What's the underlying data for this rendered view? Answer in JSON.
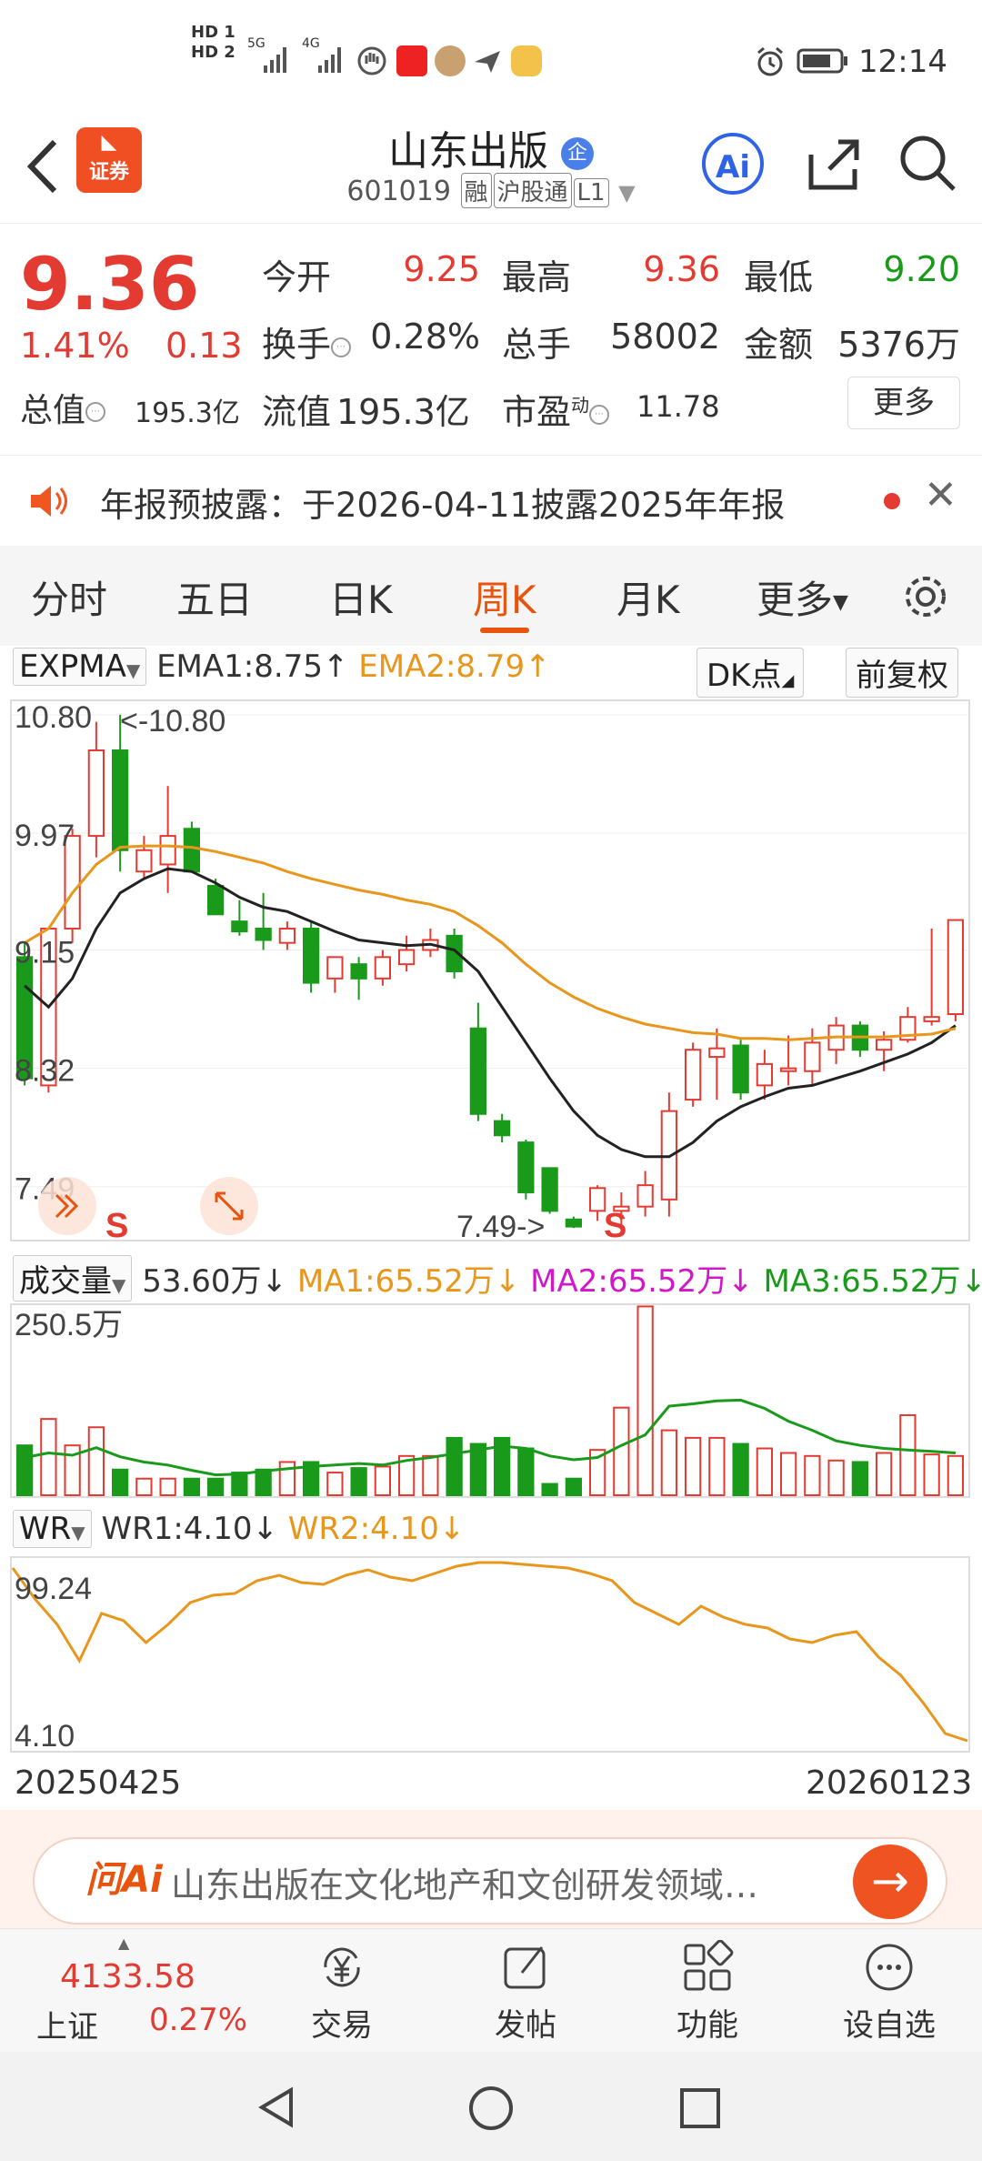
{
  "status_bar": {
    "time": "12:14",
    "sim1": "HD 1",
    "sim2": "HD 2",
    "net1": "5G",
    "net2": "4G"
  },
  "header": {
    "back_icon": "back-arrow-icon",
    "app_logo_label": "证券",
    "title": "山东出版",
    "title_badge": "企",
    "code": "601019",
    "tags": [
      "融",
      "沪股通",
      "L1"
    ],
    "ai_label": "Ai"
  },
  "quote": {
    "price": "9.36",
    "change_pct": "1.41%",
    "change": "0.13",
    "mktcap_label": "总值",
    "mktcap_value": "195.3亿",
    "open_label": "今开",
    "open_value": "9.25",
    "high_label": "最高",
    "high_value": "9.36",
    "low_label": "最低",
    "low_value": "9.20",
    "turnover_label": "换手",
    "turnover_value": "0.28%",
    "volume_label": "总手",
    "volume_value": "58002",
    "amount_label": "金额",
    "amount_value": "5376万",
    "float_label": "流值",
    "float_value": "195.3亿",
    "pe_label": "市盈",
    "pe_sup": "动",
    "pe_value": "11.78",
    "more_label": "更多"
  },
  "notice": {
    "text": "年报预披露：于2026-04-11披露2025年年报"
  },
  "tabs": {
    "items": [
      "分时",
      "五日",
      "日K",
      "周K",
      "月K",
      "更多"
    ],
    "active": "周K"
  },
  "ema_header": {
    "indicator": "EXPMA",
    "ema1": "EMA1:8.75↑",
    "ema2": "EMA2:8.79↑",
    "dk_label": "DK点",
    "adjust_label": "前复权"
  },
  "vol_header": {
    "indicator": "成交量",
    "value": "53.60万↓",
    "ma1": "MA1:65.52万↓",
    "ma2": "MA2:65.52万↓",
    "ma3": "MA3:65.52万↓"
  },
  "wr_header": {
    "indicator": "WR",
    "wr1": "WR1:4.10↓",
    "wr2": "WR2:4.10↓"
  },
  "date_range": {
    "start": "20250425",
    "end": "20260123"
  },
  "ai_bar": {
    "logo": "问Ai",
    "query": "山东出版在文化地产和文创研发领域…"
  },
  "bottom_nav": {
    "index_value": "4133.58",
    "index_name": "上证",
    "index_pct": "0.27%",
    "items": [
      "交易",
      "发帖",
      "功能",
      "设自选"
    ]
  },
  "colors": {
    "up": "#e33a31",
    "down": "#1a9a1a",
    "accent": "#e8540e",
    "ema1": "#222222",
    "ema2": "#e8961c"
  },
  "chart_data": [
    {
      "type": "candlestick",
      "title": "周K",
      "ylim": [
        7.49,
        10.8
      ],
      "y_ticks": [
        "10.80",
        "9.97",
        "9.15",
        "8.32",
        "7.49"
      ],
      "max_marker": "<-10.80",
      "min_marker": "7.49->",
      "signals": [
        "S",
        "S"
      ],
      "candles": [
        {
          "o": 9.1,
          "h": 9.2,
          "l": 8.2,
          "c": 8.25
        },
        {
          "o": 8.2,
          "h": 9.3,
          "l": 8.15,
          "c": 9.3
        },
        {
          "o": 9.3,
          "h": 10.0,
          "l": 9.2,
          "c": 9.95
        },
        {
          "o": 9.95,
          "h": 10.75,
          "l": 9.8,
          "c": 10.55
        },
        {
          "o": 10.55,
          "h": 10.8,
          "l": 9.7,
          "c": 9.85
        },
        {
          "o": 9.7,
          "h": 9.95,
          "l": 9.65,
          "c": 9.85
        },
        {
          "o": 9.75,
          "h": 10.3,
          "l": 9.55,
          "c": 9.95
        },
        {
          "o": 10.0,
          "h": 10.05,
          "l": 9.7,
          "c": 9.7
        },
        {
          "o": 9.6,
          "h": 9.65,
          "l": 9.4,
          "c": 9.4
        },
        {
          "o": 9.35,
          "h": 9.5,
          "l": 9.25,
          "c": 9.28
        },
        {
          "o": 9.3,
          "h": 9.55,
          "l": 9.15,
          "c": 9.22
        },
        {
          "o": 9.2,
          "h": 9.35,
          "l": 9.15,
          "c": 9.3
        },
        {
          "o": 9.3,
          "h": 9.35,
          "l": 8.85,
          "c": 8.92
        },
        {
          "o": 8.95,
          "h": 9.1,
          "l": 8.85,
          "c": 9.1
        },
        {
          "o": 9.05,
          "h": 9.1,
          "l": 8.8,
          "c": 8.95
        },
        {
          "o": 8.95,
          "h": 9.15,
          "l": 8.9,
          "c": 9.1
        },
        {
          "o": 9.05,
          "h": 9.25,
          "l": 9.0,
          "c": 9.15
        },
        {
          "o": 9.15,
          "h": 9.3,
          "l": 9.1,
          "c": 9.22
        },
        {
          "o": 9.25,
          "h": 9.3,
          "l": 8.95,
          "c": 9.0
        },
        {
          "o": 8.6,
          "h": 8.78,
          "l": 7.95,
          "c": 8.0
        },
        {
          "o": 7.95,
          "h": 8.0,
          "l": 7.8,
          "c": 7.85
        },
        {
          "o": 7.8,
          "h": 7.82,
          "l": 7.4,
          "c": 7.45
        },
        {
          "o": 7.62,
          "h": 7.62,
          "l": 7.3,
          "c": 7.32
        },
        {
          "o": 7.26,
          "h": 7.28,
          "l": 7.2,
          "c": 7.21
        },
        {
          "o": 7.32,
          "h": 7.5,
          "l": 7.25,
          "c": 7.48
        },
        {
          "o": 7.32,
          "h": 7.45,
          "l": 7.22,
          "c": 7.35
        },
        {
          "o": 7.35,
          "h": 7.6,
          "l": 7.28,
          "c": 7.5
        },
        {
          "o": 7.4,
          "h": 8.15,
          "l": 7.28,
          "c": 8.02
        },
        {
          "o": 8.1,
          "h": 8.5,
          "l": 8.05,
          "c": 8.45
        },
        {
          "o": 8.4,
          "h": 8.6,
          "l": 8.1,
          "c": 8.46
        },
        {
          "o": 8.48,
          "h": 8.52,
          "l": 8.1,
          "c": 8.15
        },
        {
          "o": 8.2,
          "h": 8.45,
          "l": 8.1,
          "c": 8.35
        },
        {
          "o": 8.3,
          "h": 8.55,
          "l": 8.2,
          "c": 8.32
        },
        {
          "o": 8.3,
          "h": 8.6,
          "l": 8.2,
          "c": 8.5
        },
        {
          "o": 8.45,
          "h": 8.68,
          "l": 8.35,
          "c": 8.62
        },
        {
          "o": 8.62,
          "h": 8.65,
          "l": 8.4,
          "c": 8.45
        },
        {
          "o": 8.45,
          "h": 8.58,
          "l": 8.3,
          "c": 8.52
        },
        {
          "o": 8.52,
          "h": 8.75,
          "l": 8.5,
          "c": 8.68
        },
        {
          "o": 8.65,
          "h": 9.3,
          "l": 8.62,
          "c": 8.68
        },
        {
          "o": 8.7,
          "h": 9.36,
          "l": 8.65,
          "c": 9.36
        }
      ],
      "ema1": [
        8.9,
        8.75,
        8.95,
        9.3,
        9.55,
        9.65,
        9.72,
        9.7,
        9.62,
        9.52,
        9.45,
        9.42,
        9.35,
        9.28,
        9.22,
        9.2,
        9.18,
        9.19,
        9.15,
        9.0,
        8.75,
        8.5,
        8.25,
        8.02,
        7.85,
        7.75,
        7.7,
        7.7,
        7.8,
        7.95,
        8.05,
        8.12,
        8.18,
        8.2,
        8.25,
        8.3,
        8.36,
        8.42,
        8.5,
        8.62
      ],
      "ema2": [
        9.2,
        9.3,
        9.55,
        9.75,
        9.87,
        9.88,
        9.88,
        9.87,
        9.84,
        9.8,
        9.76,
        9.7,
        9.65,
        9.61,
        9.57,
        9.54,
        9.5,
        9.47,
        9.42,
        9.32,
        9.2,
        9.05,
        8.92,
        8.82,
        8.74,
        8.68,
        8.63,
        8.6,
        8.57,
        8.56,
        8.53,
        8.53,
        8.52,
        8.53,
        8.54,
        8.54,
        8.54,
        8.55,
        8.56,
        8.6
      ]
    },
    {
      "type": "bar",
      "title": "成交量",
      "ylim": [
        0,
        250.5
      ],
      "y_ticks": [
        "250.5万"
      ],
      "values": [
        66,
        101,
        66,
        90,
        34,
        22,
        22,
        22,
        22,
        30,
        34,
        44,
        44,
        30,
        36,
        38,
        52,
        52,
        76,
        68,
        76,
        62,
        15,
        22,
        60,
        116,
        250,
        86,
        76,
        76,
        68,
        62,
        56,
        52,
        46,
        44,
        56,
        106,
        54,
        52
      ],
      "ma_line": [
        50,
        56,
        53,
        63,
        51,
        44,
        40,
        33,
        27,
        28,
        32,
        35,
        38,
        40,
        42,
        40,
        46,
        50,
        55,
        60,
        65,
        62,
        52,
        47,
        50,
        66,
        80,
        118,
        121,
        125,
        126,
        115,
        98,
        86,
        72,
        66,
        62,
        60,
        58,
        56
      ]
    },
    {
      "type": "line",
      "title": "WR",
      "ylim": [
        4.1,
        99.24
      ],
      "y_ticks": [
        "99.24",
        "4.10"
      ],
      "x_range": [
        "20250425",
        "20260123"
      ],
      "values": [
        99,
        82,
        68,
        48,
        74,
        70,
        58,
        68,
        80,
        84,
        85,
        92,
        95,
        91,
        90,
        95,
        98,
        94,
        92,
        96,
        100,
        102,
        102,
        101,
        100,
        99,
        96,
        92,
        80,
        74,
        68,
        78,
        72,
        68,
        66,
        60,
        58,
        62,
        64,
        50,
        40,
        25,
        8,
        4
      ]
    }
  ]
}
